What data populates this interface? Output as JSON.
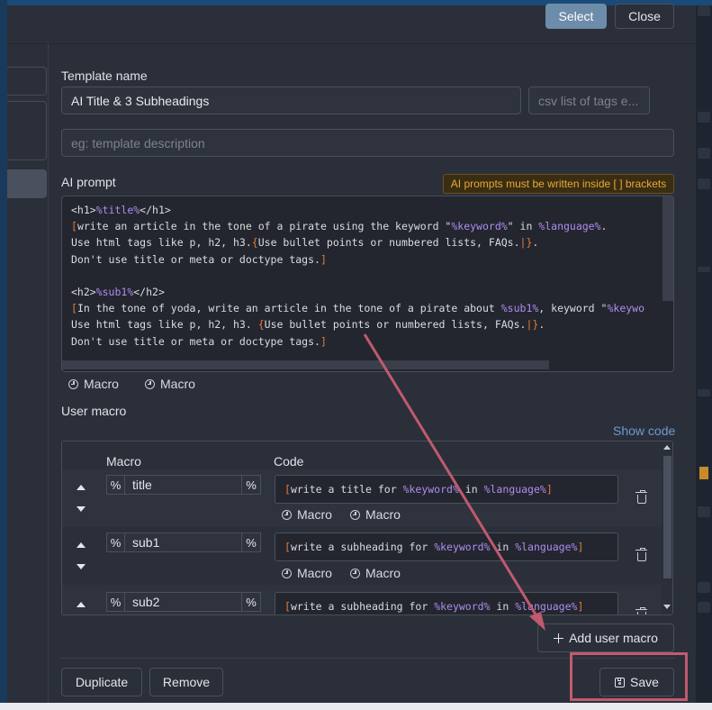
{
  "header": {
    "select_label": "Select",
    "close_label": "Close"
  },
  "template": {
    "name_label": "Template name",
    "name_value": "AI Title & 3 Subheadings",
    "tags_placeholder": "csv list of tags e...",
    "description_placeholder": "eg: template description"
  },
  "prompt": {
    "label": "AI prompt",
    "warning": "AI prompts must be written inside [ ] brackets",
    "lines": [
      [
        {
          "t": "<h1>",
          "c": "tag"
        },
        {
          "t": "%title%",
          "c": "var"
        },
        {
          "t": "</h1>",
          "c": "tag"
        }
      ],
      [
        {
          "t": "[",
          "c": "brk"
        },
        {
          "t": "write an article in the tone of a pirate using the keyword \"",
          "c": "tag"
        },
        {
          "t": "%keyword%",
          "c": "var"
        },
        {
          "t": "\" in ",
          "c": "tag"
        },
        {
          "t": "%language%",
          "c": "var"
        },
        {
          "t": ".",
          "c": "tag"
        }
      ],
      [
        {
          "t": "Use html tags like p, h2, h3.",
          "c": "tag"
        },
        {
          "t": "{",
          "c": "brk"
        },
        {
          "t": "Use bullet points or numbered lists, FAQs.",
          "c": "tag"
        },
        {
          "t": "|",
          "c": "brk"
        },
        {
          "t": "}",
          "c": "brk"
        },
        {
          "t": ".",
          "c": "tag"
        }
      ],
      [
        {
          "t": "Don't use title or meta or doctype tags.",
          "c": "tag"
        },
        {
          "t": "]",
          "c": "brk"
        }
      ],
      [
        {
          "t": "",
          "c": "tag"
        }
      ],
      [
        {
          "t": "<h2>",
          "c": "tag"
        },
        {
          "t": "%sub1%",
          "c": "var"
        },
        {
          "t": "</h2>",
          "c": "tag"
        }
      ],
      [
        {
          "t": "[",
          "c": "brk"
        },
        {
          "t": "In the tone of yoda, write an article in the tone of a pirate about ",
          "c": "tag"
        },
        {
          "t": "%sub1%",
          "c": "var"
        },
        {
          "t": ", keyword \"",
          "c": "tag"
        },
        {
          "t": "%keywo",
          "c": "var"
        }
      ],
      [
        {
          "t": "Use html tags like p, h2, h3. ",
          "c": "tag"
        },
        {
          "t": "{",
          "c": "brk"
        },
        {
          "t": "Use bullet points or numbered lists, FAQs.",
          "c": "tag"
        },
        {
          "t": "|",
          "c": "brk"
        },
        {
          "t": "}",
          "c": "brk"
        },
        {
          "t": ".",
          "c": "tag"
        }
      ],
      [
        {
          "t": "Don't use title or meta or doctype tags.",
          "c": "tag"
        },
        {
          "t": "]",
          "c": "brk"
        }
      ]
    ],
    "macro_links": [
      "Macro",
      "Macro"
    ]
  },
  "user_macro": {
    "label": "User macro",
    "show_code": "Show code",
    "col_macro": "Macro",
    "col_code": "Code",
    "pct": "%",
    "rows": [
      {
        "name": "title",
        "code": [
          {
            "t": "[",
            "c": "brk"
          },
          {
            "t": "write a title for ",
            "c": "tag"
          },
          {
            "t": "%keyword%",
            "c": "var"
          },
          {
            "t": " in ",
            "c": "tag"
          },
          {
            "t": "%language%",
            "c": "var"
          },
          {
            "t": "]",
            "c": "brk"
          }
        ],
        "macro_links": [
          "Macro",
          "Macro"
        ]
      },
      {
        "name": "sub1",
        "code": [
          {
            "t": "[",
            "c": "brk"
          },
          {
            "t": "write a subheading for ",
            "c": "tag"
          },
          {
            "t": "%keyword%",
            "c": "var"
          },
          {
            "t": " in ",
            "c": "tag"
          },
          {
            "t": "%language%",
            "c": "var"
          },
          {
            "t": "]",
            "c": "brk"
          }
        ],
        "macro_links": [
          "Macro",
          "Macro"
        ]
      },
      {
        "name": "sub2",
        "code": [
          {
            "t": "[",
            "c": "brk"
          },
          {
            "t": "write a subheading for ",
            "c": "tag"
          },
          {
            "t": "%keyword%",
            "c": "var"
          },
          {
            "t": " in ",
            "c": "tag"
          },
          {
            "t": "%language%",
            "c": "var"
          },
          {
            "t": "]",
            "c": "brk"
          }
        ],
        "macro_links": []
      }
    ],
    "add_label": "Add user macro"
  },
  "footer": {
    "duplicate_label": "Duplicate",
    "remove_label": "Remove",
    "save_label": "Save"
  },
  "colors": {
    "accent": "#6d8caa",
    "variable": "#b08cf2",
    "bracket": "#e37b3a",
    "warning": "#e6a93a",
    "annotation": "#c05a6e"
  }
}
